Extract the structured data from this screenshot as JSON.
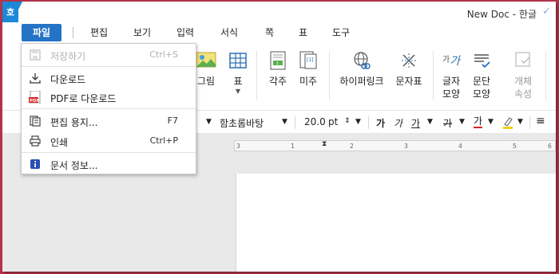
{
  "titlebar": {
    "app_icon_text": "호",
    "doc_title": "New Doc - 한글",
    "check_icon": "✓"
  },
  "menubar": {
    "items": [
      {
        "label": "파일"
      },
      {
        "label": "편집"
      },
      {
        "label": "보기"
      },
      {
        "label": "입력"
      },
      {
        "label": "서식"
      },
      {
        "label": "쪽"
      },
      {
        "label": "표"
      },
      {
        "label": "도구"
      }
    ]
  },
  "ribbon": {
    "picture": "그림",
    "table": "표",
    "footnote": "각주",
    "endnote": "미주",
    "hyperlink": "하이퍼링크",
    "char_table": "문자표",
    "char_shape_1": "글자",
    "char_shape_2": "모양",
    "para_shape_1": "문단",
    "para_shape_2": "모양",
    "obj_prop_1": "개체",
    "obj_prop_2": "속성",
    "footnote_icon_text": "1",
    "endnote_icon_text": "[1]",
    "char_shape_icon_1": "가",
    "char_shape_icon_2": "가"
  },
  "fmtbar": {
    "font_name": "함초롬바탕",
    "font_size": "20.0",
    "font_unit": "pt",
    "bold": "가",
    "italic": "가",
    "underline": "가",
    "strike": "가",
    "font_color": "가"
  },
  "ruler": {
    "ticks": [
      "3",
      "1",
      "2",
      "3",
      "4",
      "5",
      "6"
    ]
  },
  "file_menu": {
    "items": [
      {
        "label": "저장하기",
        "shortcut": "Ctrl+S",
        "disabled": true
      },
      {
        "label": "다운로드",
        "shortcut": ""
      },
      {
        "label": "PDF로 다운로드",
        "shortcut": "",
        "icon_text": "PDF"
      },
      {
        "label": "편집 용지...",
        "shortcut": "F7"
      },
      {
        "label": "인쇄",
        "shortcut": "Ctrl+P"
      },
      {
        "label": "문서 정보...",
        "shortcut": ""
      }
    ]
  },
  "colors": {
    "accent": "#2573c4",
    "app_icon": "#1e88d8",
    "background": "#b5324a",
    "font_color_underline": "#d62020",
    "highlight": "#f2d21e"
  }
}
